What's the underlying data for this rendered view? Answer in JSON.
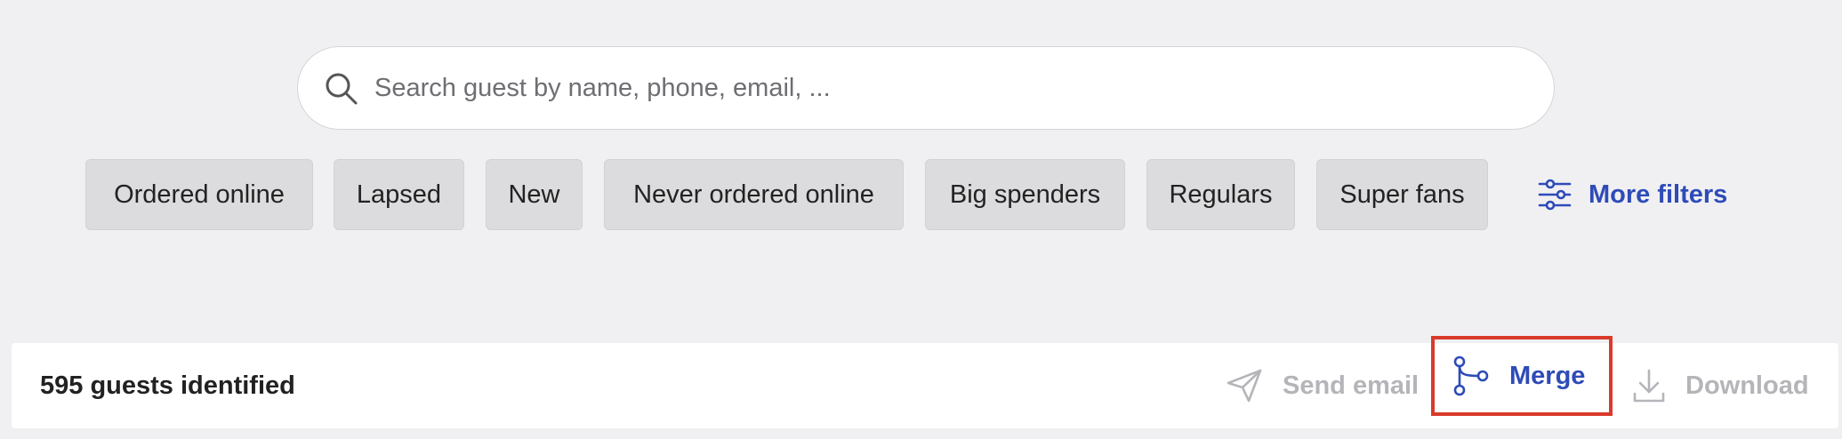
{
  "search": {
    "placeholder": "Search guest by name, phone, email, ...",
    "value": ""
  },
  "filters": {
    "chips": [
      {
        "label": "Ordered online"
      },
      {
        "label": "Lapsed"
      },
      {
        "label": "New"
      },
      {
        "label": "Never ordered online"
      },
      {
        "label": "Big spenders"
      },
      {
        "label": "Regulars"
      },
      {
        "label": "Super fans"
      }
    ],
    "more_filters_label": "More filters",
    "more_filters_icon": "sliders-icon"
  },
  "results": {
    "count_label": "595 guests identified",
    "actions": {
      "send_email": {
        "label": "Send email",
        "icon": "paper-plane-icon",
        "enabled": false
      },
      "merge": {
        "label": "Merge",
        "icon": "merge-icon",
        "enabled": true,
        "highlighted": true
      },
      "download": {
        "label": "Download",
        "icon": "download-icon",
        "enabled": false
      }
    }
  },
  "colors": {
    "page_background": "#f0f0f2",
    "chip_background": "#dcdcde",
    "accent_blue": "#2e4bb8",
    "disabled_gray": "#b5b5b9",
    "highlight_red": "#d93a2b"
  }
}
